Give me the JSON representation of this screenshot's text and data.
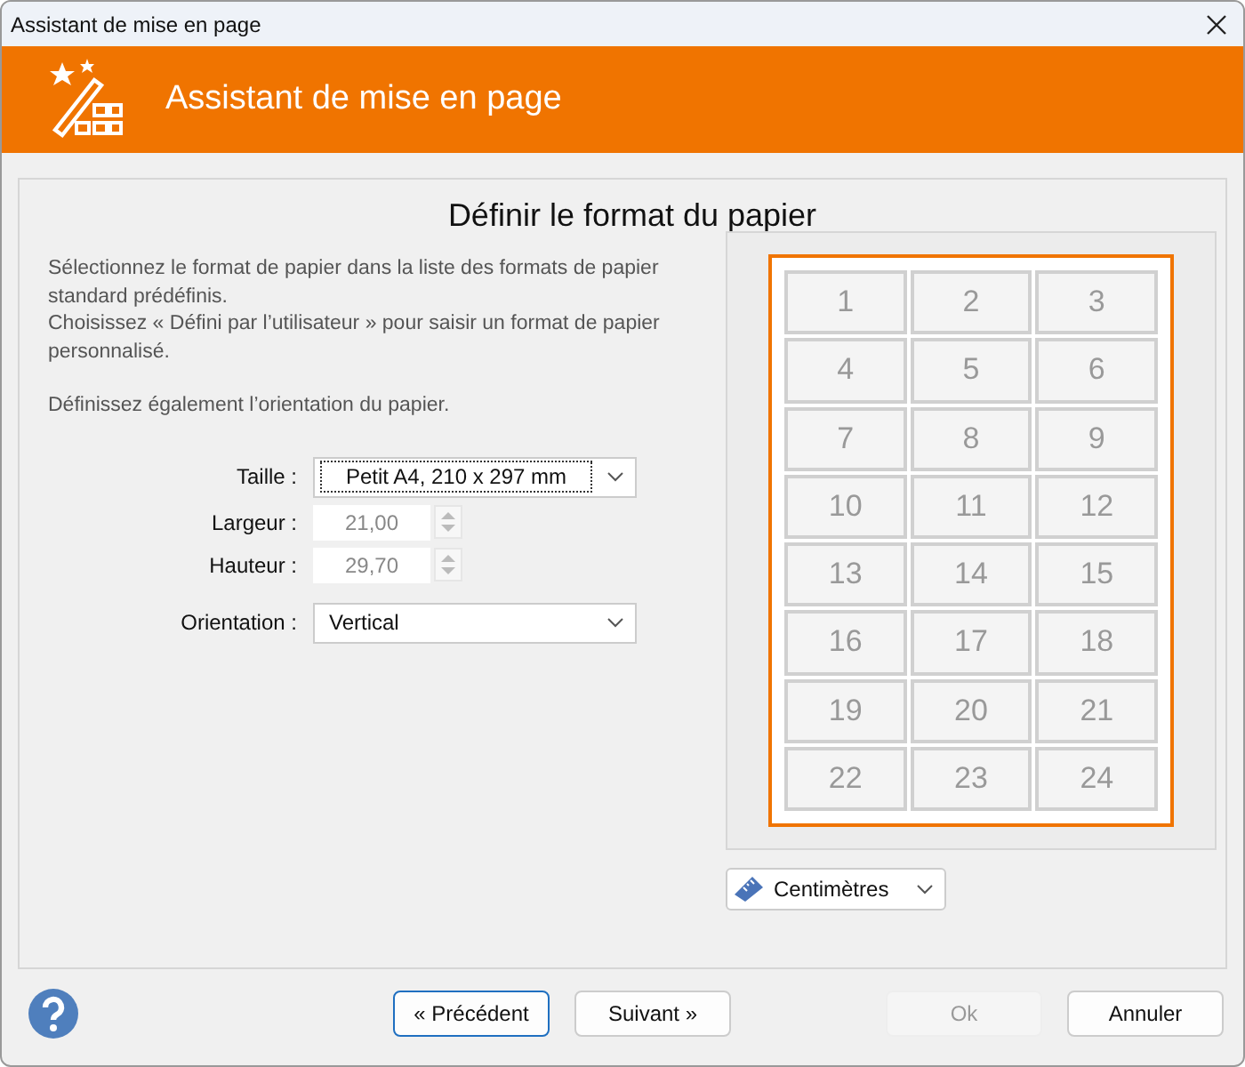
{
  "window": {
    "title": "Assistant de mise en page"
  },
  "header": {
    "title": "Assistant de mise en page"
  },
  "heading": "Définir le format du papier",
  "description": [
    "Sélectionnez le format de papier dans la liste des formats de papier standard prédéfinis.",
    "Choisissez « Défini par l’utilisateur » pour saisir un format de papier personnalisé.",
    "Définissez également l’orientation du papier."
  ],
  "fields": [
    {
      "kind": "dropdown",
      "label": "Taille :",
      "value": "Petit A4, 210 x 297 mm",
      "focused": true
    },
    {
      "kind": "spinner",
      "label": "Largeur :",
      "value": "21,00",
      "disabled": true
    },
    {
      "kind": "spinner",
      "label": "Hauteur :",
      "value": "29,70",
      "disabled": true
    },
    {
      "kind": "dropdown",
      "label": "Orientation :",
      "value": "Vertical",
      "focused": false
    }
  ],
  "preview": {
    "labels": [
      "1",
      "2",
      "3",
      "4",
      "5",
      "6",
      "7",
      "8",
      "9",
      "10",
      "11",
      "12",
      "13",
      "14",
      "15",
      "16",
      "17",
      "18",
      "19",
      "20",
      "21",
      "22",
      "23",
      "24"
    ]
  },
  "units": {
    "value": "Centimètres"
  },
  "buttons": [
    {
      "label": "« Précédent",
      "default": true,
      "disabled": false
    },
    {
      "label": "Suivant »",
      "default": false,
      "disabled": false
    },
    {
      "label": "Ok",
      "default": false,
      "disabled": true
    },
    {
      "label": "Annuler",
      "default": false,
      "disabled": false
    }
  ]
}
